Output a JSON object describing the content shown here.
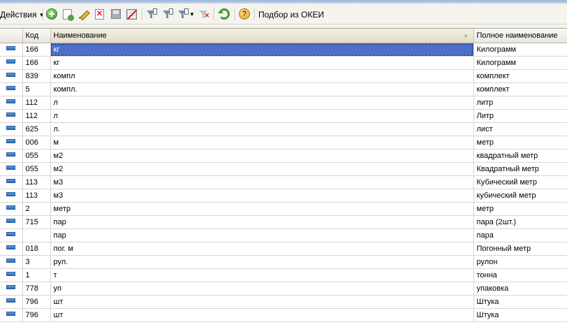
{
  "toolbar": {
    "actions_label": "Действия",
    "okei_label": "Подбор из ОКЕИ",
    "icons": [
      "add-icon",
      "copy-icon",
      "edit-icon",
      "delete-icon",
      "save-icon",
      "clear-icon",
      "filter-icon",
      "filter-list-icon",
      "filter-dropdown-icon",
      "filter-off-icon",
      "refresh-icon",
      "help-icon"
    ]
  },
  "columns": {
    "code": "Код",
    "name": "Наименование",
    "full_name": "Полное наименование"
  },
  "rows": [
    {
      "code": "166",
      "name": "кг",
      "full_name": "Килограмм",
      "selected": true
    },
    {
      "code": "166",
      "name": "кг",
      "full_name": "Килограмм"
    },
    {
      "code": "839",
      "name": "компл",
      "full_name": "комплект"
    },
    {
      "code": "5",
      "name": "компл.",
      "full_name": "комплект"
    },
    {
      "code": "112",
      "name": "л",
      "full_name": "литр"
    },
    {
      "code": "112",
      "name": "л",
      "full_name": "Литр"
    },
    {
      "code": "625",
      "name": "л.",
      "full_name": "лист"
    },
    {
      "code": "006",
      "name": "м",
      "full_name": "метр"
    },
    {
      "code": "055",
      "name": "м2",
      "full_name": "квадратный метр"
    },
    {
      "code": "055",
      "name": "м2",
      "full_name": "Квадратный метр"
    },
    {
      "code": "113",
      "name": "м3",
      "full_name": "Кубический метр"
    },
    {
      "code": "113",
      "name": "м3",
      "full_name": "кубический метр"
    },
    {
      "code": "2",
      "name": "метр",
      "full_name": "метр"
    },
    {
      "code": "715",
      "name": "пар",
      "full_name": "пара (2шт.)"
    },
    {
      "code": "",
      "name": "пар",
      "full_name": "пара"
    },
    {
      "code": "018",
      "name": "пог. м",
      "full_name": "Погонный метр"
    },
    {
      "code": "3",
      "name": "рул.",
      "full_name": "рулон"
    },
    {
      "code": "1",
      "name": "т",
      "full_name": "тонна"
    },
    {
      "code": "778",
      "name": "уп",
      "full_name": "упаковка"
    },
    {
      "code": "796",
      "name": "шт",
      "full_name": "Штука"
    },
    {
      "code": "796",
      "name": "шт",
      "full_name": "Штука"
    }
  ]
}
